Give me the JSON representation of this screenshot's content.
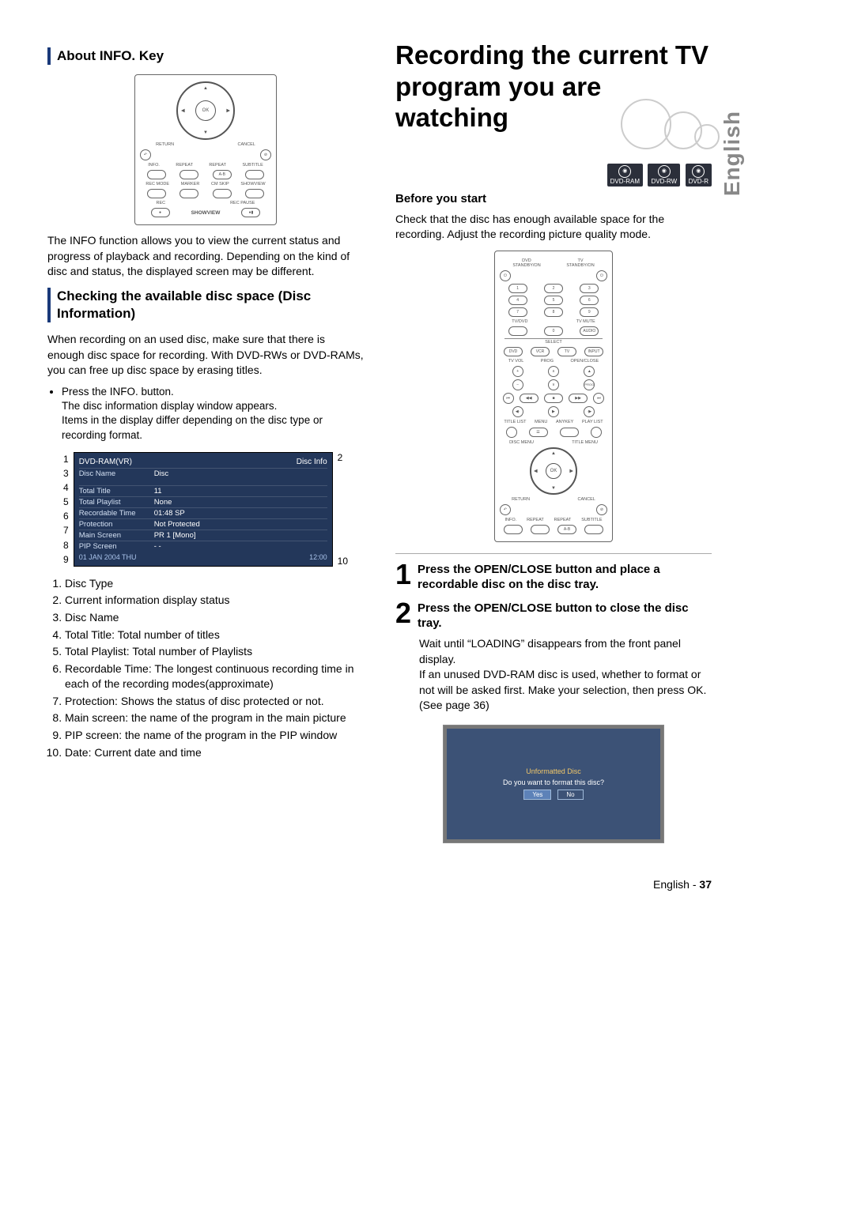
{
  "section_about": "About INFO. Key",
  "about_paragraph": "The INFO function allows you to view the current status and progress of playback and recording. Depending on the kind of disc and status, the displayed screen may be different.",
  "section_checking": "Checking the available disc space (Disc Information)",
  "checking_paragraph": "When recording on an used disc, make sure that there is enough disc space for recording. With DVD-RWs or DVD-RAMs, you can free up disc space by erasing titles.",
  "press_info_bullet": "Press the INFO. button.",
  "press_info_line1": "The disc information display window appears.",
  "press_info_line2": "Items in the display differ depending on the disc type or recording format.",
  "disc_info": {
    "header_left": "DVD-RAM(VR)",
    "header_right": "Disc Info",
    "rows": [
      {
        "k": "Disc Name",
        "v": "Disc"
      },
      {
        "k": "Total Title",
        "v": "11"
      },
      {
        "k": "Total Playlist",
        "v": "None"
      },
      {
        "k": "Recordable Time",
        "v": "01:48 SP"
      },
      {
        "k": "Protection",
        "v": "Not Protected"
      },
      {
        "k": "Main Screen",
        "v": "PR 1 [Mono]"
      },
      {
        "k": "PIP Screen",
        "v": "- -"
      }
    ],
    "footer_left": "01 JAN 2004 THU",
    "footer_right": "12:00"
  },
  "legend": [
    "Disc Type",
    "Current information display status",
    "Disc Name",
    "Total Title: Total number of titles",
    "Total Playlist: Total number of Playlists",
    "Recordable Time: The longest continuous recording time in each of the recording modes(approximate)",
    "Protection: Shows the status of disc protected or not.",
    "Main screen: the name of the program in the main picture",
    "PIP screen: the name of the program in the PIP window",
    "Date: Current date and time"
  ],
  "big_title": "Recording the current TV program you are watching",
  "disc_badges": [
    "DVD-RAM",
    "DVD-RW",
    "DVD-R"
  ],
  "before_start": "Before you start",
  "before_paragraph": "Check that the disc has enough available space for the recording. Adjust the recording picture quality mode.",
  "step1_title": "Press the OPEN/CLOSE button and place a recordable disc on the disc tray.",
  "step2_title": "Press the OPEN/CLOSE button to close the disc tray.",
  "step2_body": "Wait until “LOADING” disappears from the front panel display.\nIf an unused DVD-RAM disc is used, whether to format or not will be asked first. Make your selection, then press OK. (See page 36)",
  "osd": {
    "title": "Unformatted Disc",
    "question": "Do you want to format this disc?",
    "yes": "Yes",
    "no": "No"
  },
  "remote_labels": {
    "ok": "OK",
    "return": "RETURN",
    "cancel": "CANCEL",
    "info": "INFO.",
    "repeat": "REPEAT",
    "repeat_ab": "REPEAT",
    "ab": "A-B",
    "subtitle": "SUBTITLE",
    "recmode": "REC MODE",
    "marker": "MARKER",
    "cmskip": "CM SKIP",
    "showview_small": "SHOWVIEW",
    "rec": "REC",
    "showview": "SHOWVIEW",
    "recpause": "REC PAUSE"
  },
  "full_remote": {
    "top_left": "DVD\nSTANDBY/ON",
    "top_right": "TV\nSTANDBY/ON",
    "tvdvd": "TV/DVD",
    "tvmute": "TV MUTE",
    "audio": "AUDIO",
    "select": "SELECT",
    "dvd": "DVD",
    "tv": "TV",
    "vcr": "VCR",
    "input": "INPUT",
    "tvvol": "TV VOL",
    "prog": "PROG",
    "openclose": "OPEN/CLOSE",
    "progup": "PROG",
    "titlelist": "TITLE LIST",
    "menu": "MENU",
    "anykey": "ANYKEY",
    "playlist": "PLAY LIST",
    "discmenu": "DISC MENU",
    "titlemenu": "TITLE MENU",
    "ok": "OK",
    "return": "RETURN",
    "cancel": "CANCEL",
    "info": "INFO.",
    "repeat": "REPEAT",
    "ab": "A-B",
    "subtitle": "SUBTITLE"
  },
  "lang_tab": "English",
  "footer_lang": "English",
  "footer_page": "37",
  "leader_left": [
    "1",
    "3",
    "4",
    "5",
    "6",
    "7",
    "8",
    "9"
  ],
  "leader_right_top": "2",
  "leader_right_bottom": "10"
}
